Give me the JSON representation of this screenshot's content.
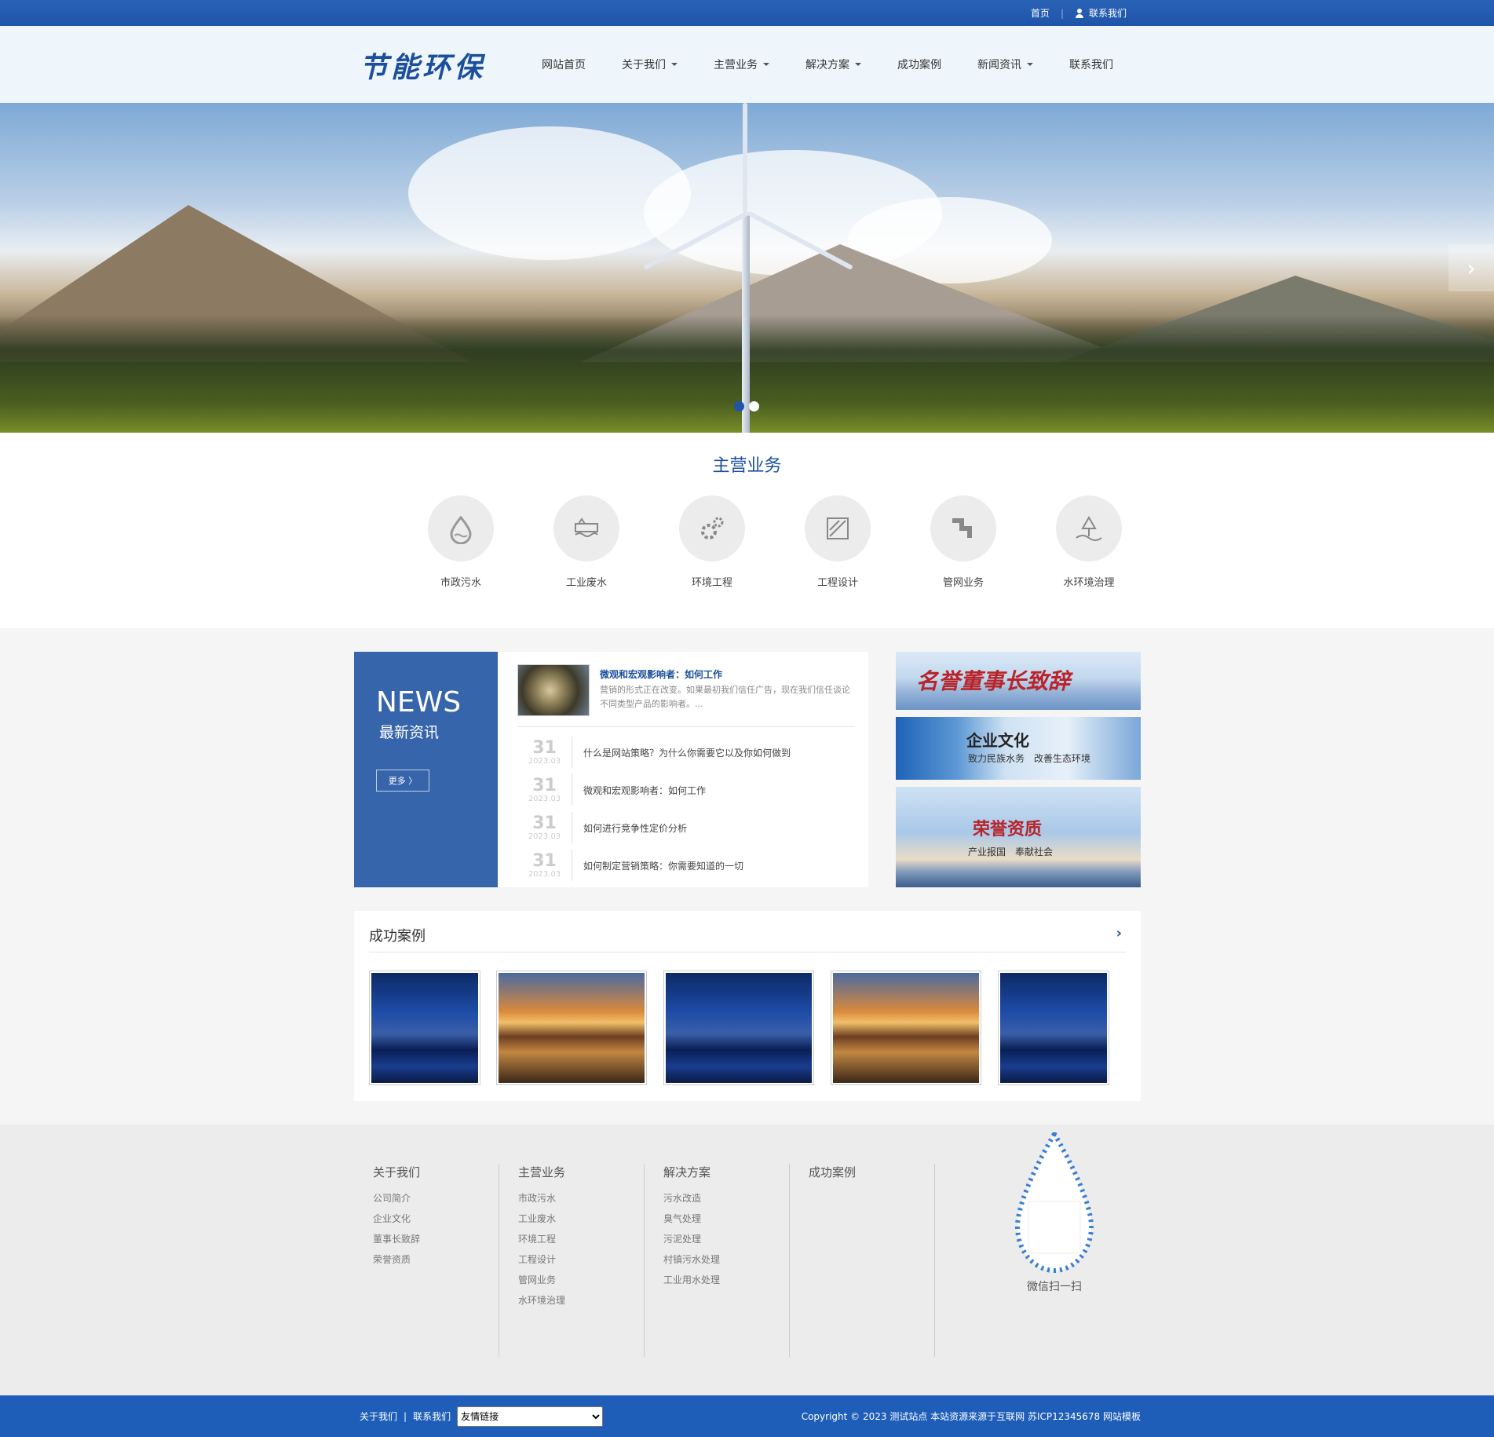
{
  "topbar": {
    "home": "首页",
    "contact": "联系我们"
  },
  "header": {
    "logo": "节能环保",
    "nav": [
      {
        "label": "网站首页",
        "has_caret": false
      },
      {
        "label": "关于我们",
        "has_caret": true
      },
      {
        "label": "主营业务",
        "has_caret": true
      },
      {
        "label": "解决方案",
        "has_caret": true
      },
      {
        "label": "成功案例",
        "has_caret": false
      },
      {
        "label": "新闻资讯",
        "has_caret": true
      },
      {
        "label": "联系我们",
        "has_caret": false
      }
    ]
  },
  "banner": {
    "slides": 2,
    "active_slide": 1,
    "next_arrow": "›"
  },
  "services": {
    "title": "主营业务",
    "items": [
      {
        "label": "市政污水",
        "icon": "water-drop-icon"
      },
      {
        "label": "工业废水",
        "icon": "factory-wave-icon"
      },
      {
        "label": "环境工程",
        "icon": "gears-icon"
      },
      {
        "label": "工程设计",
        "icon": "blueprint-icon"
      },
      {
        "label": "管网业务",
        "icon": "pipe-icon"
      },
      {
        "label": "水环境治理",
        "icon": "tree-landscape-icon"
      }
    ]
  },
  "news": {
    "en_title": "NEWS",
    "cn_title": "最新资讯",
    "more": "更多 〉",
    "featured": {
      "title": "微观和宏观影响者：如何工作",
      "desc": "营销的形式正在改变。如果最初我们信任广告，现在我们信任谈论不同类型产品的影响者。..."
    },
    "items": [
      {
        "day": "31",
        "ym": "2023.03",
        "title": "什么是网站策略？为什么你需要它以及你如何做到"
      },
      {
        "day": "31",
        "ym": "2023.03",
        "title": "微观和宏观影响者：如何工作"
      },
      {
        "day": "31",
        "ym": "2023.03",
        "title": "如何进行竞争性定价分析"
      },
      {
        "day": "31",
        "ym": "2023.03",
        "title": "如何制定营销策略：你需要知道的一切"
      }
    ]
  },
  "promos": [
    {
      "big": "名誉董事长致辞",
      "small": ""
    },
    {
      "big": "企业文化",
      "small": "致力民族水务　改善生态环境"
    },
    {
      "big": "荣誉资质",
      "small": "产业报国　奉献社会"
    }
  ],
  "cases": {
    "title": "成功案例",
    "more": "›",
    "items": [
      {
        "style": "blue"
      },
      {
        "style": "gold"
      },
      {
        "style": "blue"
      },
      {
        "style": "gold"
      },
      {
        "style": "blue"
      }
    ]
  },
  "footer": {
    "columns": [
      {
        "title": "关于我们",
        "links": [
          "公司简介",
          "企业文化",
          "董事长致辞",
          "荣誉资质"
        ]
      },
      {
        "title": "主营业务",
        "links": [
          "市政污水",
          "工业废水",
          "环境工程",
          "工程设计",
          "管网业务",
          "水环境治理"
        ]
      },
      {
        "title": "解决方案",
        "links": [
          "污水改造",
          "臭气处理",
          "污泥处理",
          "村镇污水处理",
          "工业用水处理"
        ]
      },
      {
        "title": "成功案例",
        "links": []
      }
    ],
    "qr_label": "微信扫一扫"
  },
  "bottom": {
    "about": "关于我们",
    "sep": "|",
    "contact": "联系我们",
    "select_value": "友情链接",
    "copyright": "Copyright © 2023 测试站点 本站资源来源于互联网 苏ICP12345678 网站模板"
  },
  "colors": {
    "primary": "#1e55aa",
    "news_side": "#3765ab",
    "accent_red": "#b8242a"
  }
}
